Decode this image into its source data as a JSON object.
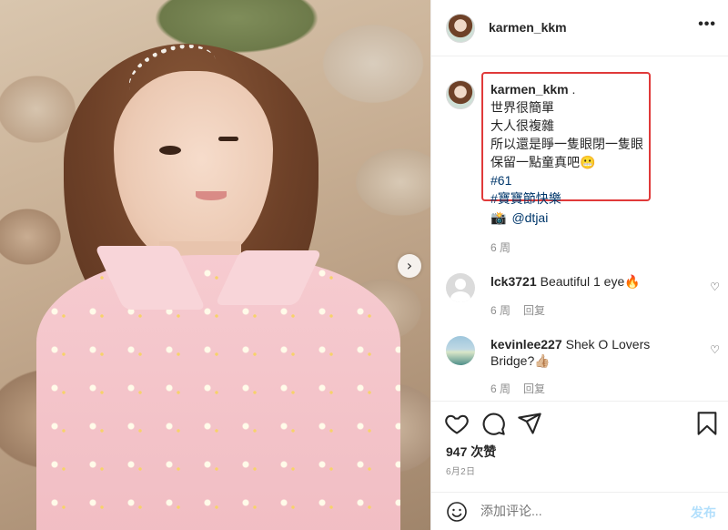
{
  "post": {
    "username": "karmen_kkm",
    "more_label": "•••",
    "next_label": "›"
  },
  "caption": {
    "username": "karmen_kkm",
    "suffix": " .",
    "lines": [
      "世界很簡單",
      "大人很複雜",
      "所以還是睜一隻眼閉一隻眼",
      "保留一點童真吧😬"
    ],
    "hashtags": [
      "#61",
      "#寶寶節快樂"
    ],
    "camera_emoji": "📸",
    "tag": "@dtjai",
    "time": "6 周"
  },
  "comments": [
    {
      "username": "lck3721",
      "text": "Beautiful 1 eye🔥",
      "time": "6 周",
      "reply": "回复"
    },
    {
      "username": "kevinlee227",
      "text_line1": "Shek O Lovers",
      "text_line2": "Bridge?👍🏼",
      "time": "6 周",
      "reply": "回复"
    }
  ],
  "likes": "947 次赞",
  "date": "6月2日",
  "add_comment": {
    "placeholder": "添加评论...",
    "post": "发布"
  },
  "colors": {
    "link": "#00376b",
    "highlight": "#e03a3a",
    "muted": "#8e8e8e",
    "post_disabled": "#b2dffc"
  }
}
